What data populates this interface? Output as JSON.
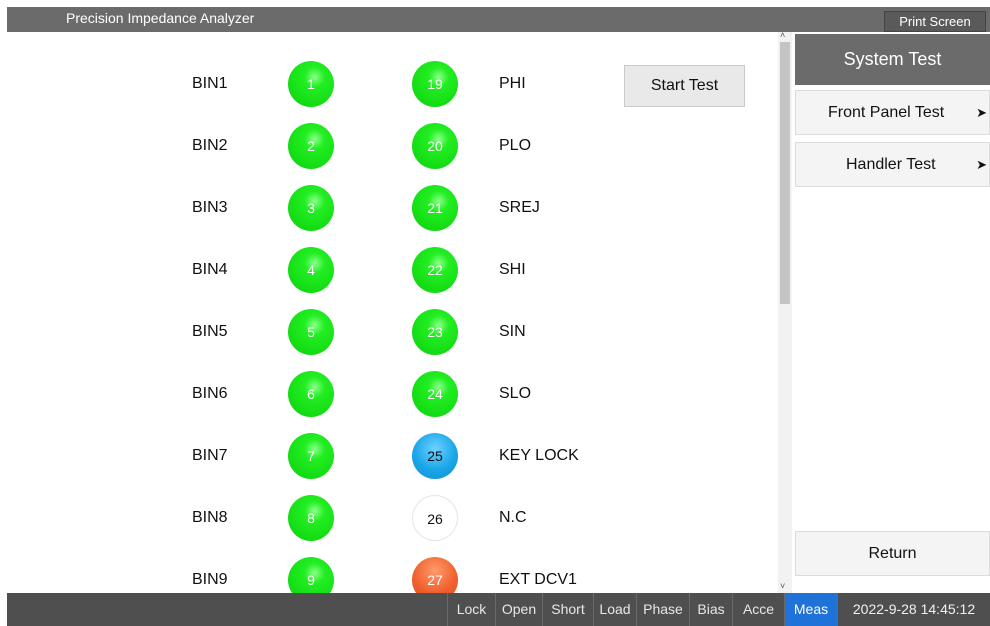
{
  "app": {
    "title": "Precision Impedance Analyzer",
    "print_screen": "Print Screen"
  },
  "test": {
    "start_label": "Start Test",
    "bins": [
      {
        "label": "BIN1",
        "num": "1"
      },
      {
        "label": "BIN2",
        "num": "2"
      },
      {
        "label": "BIN3",
        "num": "3"
      },
      {
        "label": "BIN4",
        "num": "4"
      },
      {
        "label": "BIN5",
        "num": "5"
      },
      {
        "label": "BIN6",
        "num": "6"
      },
      {
        "label": "BIN7",
        "num": "7"
      },
      {
        "label": "BIN8",
        "num": "8"
      },
      {
        "label": "BIN9",
        "num": "9"
      }
    ],
    "signals": [
      {
        "num": "19",
        "label": "PHI",
        "state": "green"
      },
      {
        "num": "20",
        "label": "PLO",
        "state": "green"
      },
      {
        "num": "21",
        "label": "SREJ",
        "state": "green"
      },
      {
        "num": "22",
        "label": "SHI",
        "state": "green"
      },
      {
        "num": "23",
        "label": "SIN",
        "state": "green"
      },
      {
        "num": "24",
        "label": "SLO",
        "state": "green"
      },
      {
        "num": "25",
        "label": "KEY LOCK",
        "state": "blue"
      },
      {
        "num": "26",
        "label": "N.C",
        "state": "white"
      },
      {
        "num": "27",
        "label": "EXT DCV1",
        "state": "orange"
      }
    ],
    "colors": {
      "green": "#14dc14",
      "blue": "#1aa6e8",
      "white": "#ffffff",
      "orange": "#f0602e"
    }
  },
  "side": {
    "header": "System Test",
    "front_panel": "Front Panel Test",
    "handler": "Handler Test",
    "arrow_glyph": "➤",
    "return": "Return"
  },
  "status": {
    "items": [
      "Lock",
      "Open",
      "Short",
      "Load",
      "Phase",
      "Bias",
      "Acce",
      "Meas"
    ],
    "active": "Meas",
    "datetime": "2022-9-28 14:45:12"
  },
  "scroll": {
    "up_icon": "chevron-up-icon",
    "down_icon": "chevron-down-icon"
  }
}
